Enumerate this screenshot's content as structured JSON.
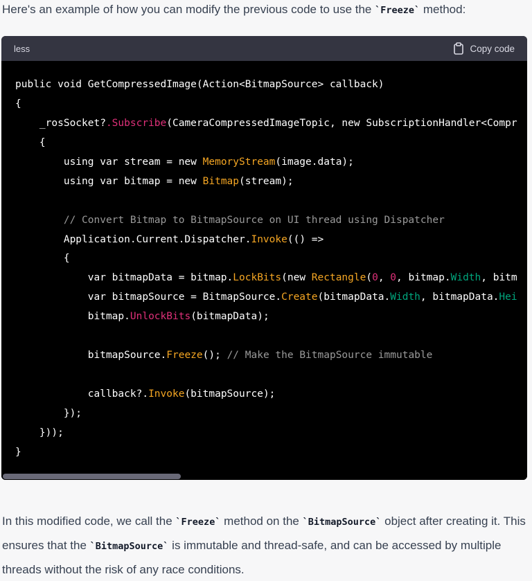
{
  "intro": {
    "before": "Here's an example of how you can modify the previous code to use the ",
    "code": "`Freeze`",
    "after": " method:"
  },
  "codeblock": {
    "language": "less",
    "copy_label": "Copy code",
    "lines": [
      [
        {
          "t": "public void GetCompressedImage(Action<BitmapSource> callback)",
          "c": "k"
        }
      ],
      [
        {
          "t": "{",
          "c": "k"
        }
      ],
      [
        {
          "t": "    _rosSocket?",
          "c": "k"
        },
        {
          "t": ".Subscribe",
          "c": "m"
        },
        {
          "t": "(CameraCompressedImageTopic, new SubscriptionHandler<Compr",
          "c": "k"
        }
      ],
      [
        {
          "t": "    {",
          "c": "k"
        }
      ],
      [
        {
          "t": "        using var stream = new ",
          "c": "k"
        },
        {
          "t": "MemoryStream",
          "c": "f"
        },
        {
          "t": "(image.data);",
          "c": "k"
        }
      ],
      [
        {
          "t": "        using var bitmap = new ",
          "c": "k"
        },
        {
          "t": "Bitmap",
          "c": "f"
        },
        {
          "t": "(stream);",
          "c": "k"
        }
      ],
      [
        {
          "t": "",
          "c": "k"
        }
      ],
      [
        {
          "t": "        // Convert Bitmap to BitmapSource on UI thread using Dispatcher",
          "c": "c"
        }
      ],
      [
        {
          "t": "        Application.Current.Dispatcher.",
          "c": "k"
        },
        {
          "t": "Invoke",
          "c": "f"
        },
        {
          "t": "(() =>",
          "c": "k"
        }
      ],
      [
        {
          "t": "        {",
          "c": "k"
        }
      ],
      [
        {
          "t": "            var bitmapData = bitmap.",
          "c": "k"
        },
        {
          "t": "LockBits",
          "c": "f"
        },
        {
          "t": "(new ",
          "c": "k"
        },
        {
          "t": "Rectangle",
          "c": "f"
        },
        {
          "t": "(",
          "c": "k"
        },
        {
          "t": "0",
          "c": "num"
        },
        {
          "t": ", ",
          "c": "k"
        },
        {
          "t": "0",
          "c": "num"
        },
        {
          "t": ", bitmap.",
          "c": "k"
        },
        {
          "t": "Width",
          "c": "n"
        },
        {
          "t": ", bitm",
          "c": "k"
        }
      ],
      [
        {
          "t": "            var bitmapSource = BitmapSource.",
          "c": "k"
        },
        {
          "t": "Create",
          "c": "f"
        },
        {
          "t": "(bitmapData.",
          "c": "k"
        },
        {
          "t": "Width",
          "c": "n"
        },
        {
          "t": ", bitmapData.",
          "c": "k"
        },
        {
          "t": "Hei",
          "c": "n"
        }
      ],
      [
        {
          "t": "            bitmap.",
          "c": "k"
        },
        {
          "t": "UnlockBits",
          "c": "m"
        },
        {
          "t": "(bitmapData);",
          "c": "k"
        }
      ],
      [
        {
          "t": "",
          "c": "k"
        }
      ],
      [
        {
          "t": "            bitmapSource.",
          "c": "k"
        },
        {
          "t": "Freeze",
          "c": "f"
        },
        {
          "t": "(); ",
          "c": "k"
        },
        {
          "t": "// Make the BitmapSource immutable",
          "c": "c"
        }
      ],
      [
        {
          "t": "",
          "c": "k"
        }
      ],
      [
        {
          "t": "            callback?.",
          "c": "k"
        },
        {
          "t": "Invoke",
          "c": "f"
        },
        {
          "t": "(bitmapSource);",
          "c": "k"
        }
      ],
      [
        {
          "t": "        });",
          "c": "k"
        }
      ],
      [
        {
          "t": "    }));",
          "c": "k"
        }
      ],
      [
        {
          "t": "}",
          "c": "k"
        }
      ]
    ]
  },
  "outro": {
    "p1": "In this modified code, we call the ",
    "c1": "`Freeze`",
    "p2": " method on the ",
    "c2": "`BitmapSource`",
    "p3": " object after creating it. This ensures that the ",
    "c3": "`BitmapSource`",
    "p4": " is immutable and thread-safe, and can be accessed by multiple threads without the risk of any race conditions."
  },
  "icons": {
    "copy": "clipboard-icon"
  }
}
